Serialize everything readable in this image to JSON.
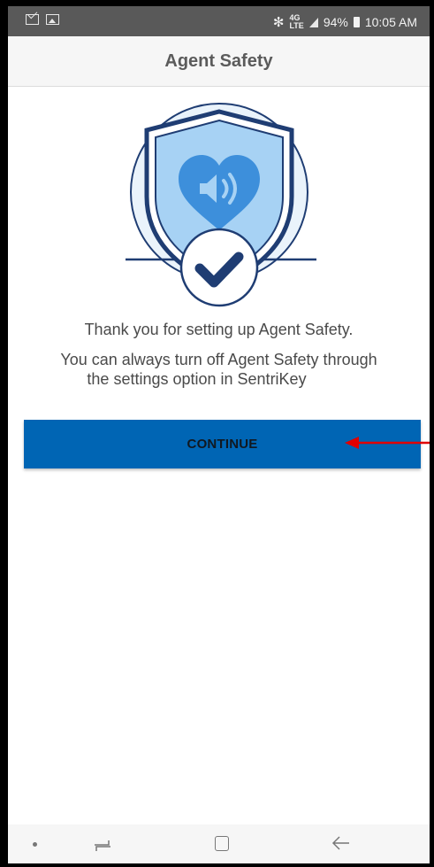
{
  "status_bar": {
    "left_icons": [
      "mail-icon",
      "image-icon"
    ],
    "bluetooth": "✻",
    "network": "4G\nLTE",
    "battery_percent": "94%",
    "time": "10:05 AM"
  },
  "app_bar": {
    "title": "Agent Safety"
  },
  "hero": {
    "icon": "shield-heart-speaker-check-icon",
    "accent": "#4a9fe0",
    "dark": "#1f3d73"
  },
  "messages": {
    "line1": "Thank you for setting up Agent Safety.",
    "line2": "You can always turn off Agent Safety through",
    "line3": "the settings option in SentriKey"
  },
  "continue_button": {
    "label": "CONTINUE",
    "color": "#0065b4"
  },
  "annotation": {
    "color": "#e00000",
    "icon": "red-arrow-icon"
  },
  "nav_bar": {
    "icons": [
      "dot-icon",
      "recents-icon",
      "home-icon",
      "back-icon"
    ]
  }
}
